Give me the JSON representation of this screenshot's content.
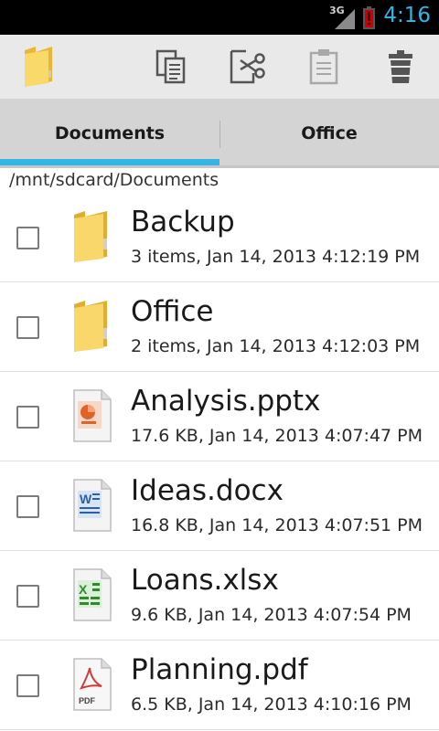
{
  "status_bar": {
    "network": "3G",
    "time": "4:16",
    "icons": [
      "signal-icon",
      "battery-alert-icon"
    ]
  },
  "toolbar": {
    "buttons": [
      {
        "name": "folder-icon"
      },
      {
        "name": "copy-icon"
      },
      {
        "name": "cut-icon"
      },
      {
        "name": "paste-icon"
      },
      {
        "name": "delete-icon"
      }
    ]
  },
  "tabs": [
    {
      "label": "Documents",
      "selected": true
    },
    {
      "label": "Office",
      "selected": false
    }
  ],
  "path": "/mnt/sdcard/Documents",
  "files": [
    {
      "name": "Backup",
      "meta": "3 items, Jan 14, 2013 4:12:19 PM",
      "icon": "folder-icon"
    },
    {
      "name": "Office",
      "meta": "2 items, Jan 14, 2013 4:12:03 PM",
      "icon": "folder-icon"
    },
    {
      "name": "Analysis.pptx",
      "meta": "17.6 KB, Jan 14, 2013 4:07:47 PM",
      "icon": "powerpoint-file-icon"
    },
    {
      "name": "Ideas.docx",
      "meta": "16.8 KB, Jan 14, 2013 4:07:51 PM",
      "icon": "word-file-icon"
    },
    {
      "name": "Loans.xlsx",
      "meta": "9.6 KB, Jan 14, 2013 4:07:54 PM",
      "icon": "excel-file-icon"
    },
    {
      "name": "Planning.pdf",
      "meta": "6.5 KB, Jan 14, 2013 4:10:16 PM",
      "icon": "pdf-file-icon",
      "badge": "PDF"
    }
  ],
  "colors": {
    "accent": "#33b5e5",
    "toolbar_bg": "#e9e9e9",
    "tabs_bg": "#d4d4d4"
  }
}
